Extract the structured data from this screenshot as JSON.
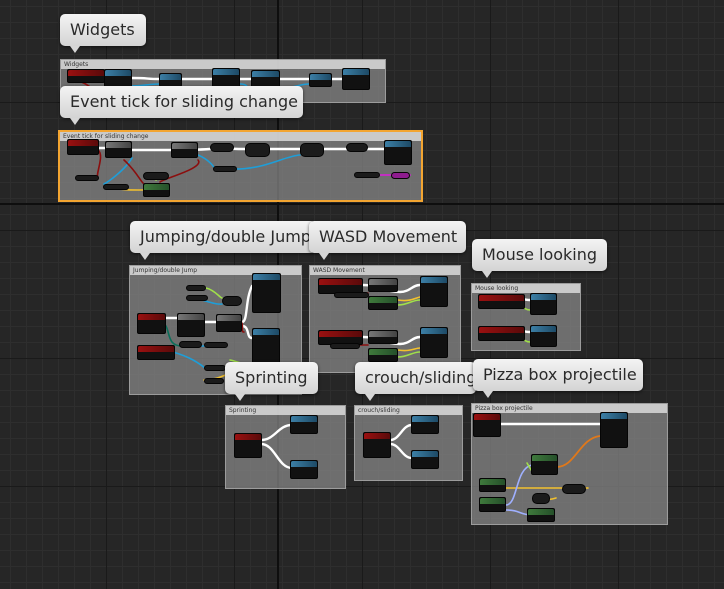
{
  "canvas": {
    "background": "#262626",
    "wire_colors": {
      "exec": "#ffffff",
      "object": "#1e9ed8",
      "bool": "#8b0e0e",
      "float": "#a0e04a",
      "byte": "#0a6e5a",
      "vector": "#f2c12e",
      "rotator": "#9fb0ff",
      "struct": "#e0781a",
      "purple": "#c030c0"
    },
    "selection_color": "#f3a531",
    "comment_fill": "#8a8a8a"
  },
  "comments": {
    "widgets": {
      "bubble": "Widgets",
      "header": "Widgets"
    },
    "event_tick": {
      "bubble": "Event tick for sliding change",
      "header": "Event tick for sliding change"
    },
    "jumping": {
      "bubble": "Jumping/double Jump",
      "header": "Jumping/double Jump"
    },
    "wasd": {
      "bubble": "WASD Movement",
      "header": "WASD Movement"
    },
    "mouse": {
      "bubble": "Mouse looking",
      "header": "Mouse looking"
    },
    "sprinting": {
      "bubble": "Sprinting",
      "header": "Sprinting"
    },
    "crouch": {
      "bubble": "crouch/sliding",
      "header": "crouch/sliding"
    },
    "pizza": {
      "bubble": "Pizza box projectile",
      "header": "Pizza box projectile"
    }
  }
}
